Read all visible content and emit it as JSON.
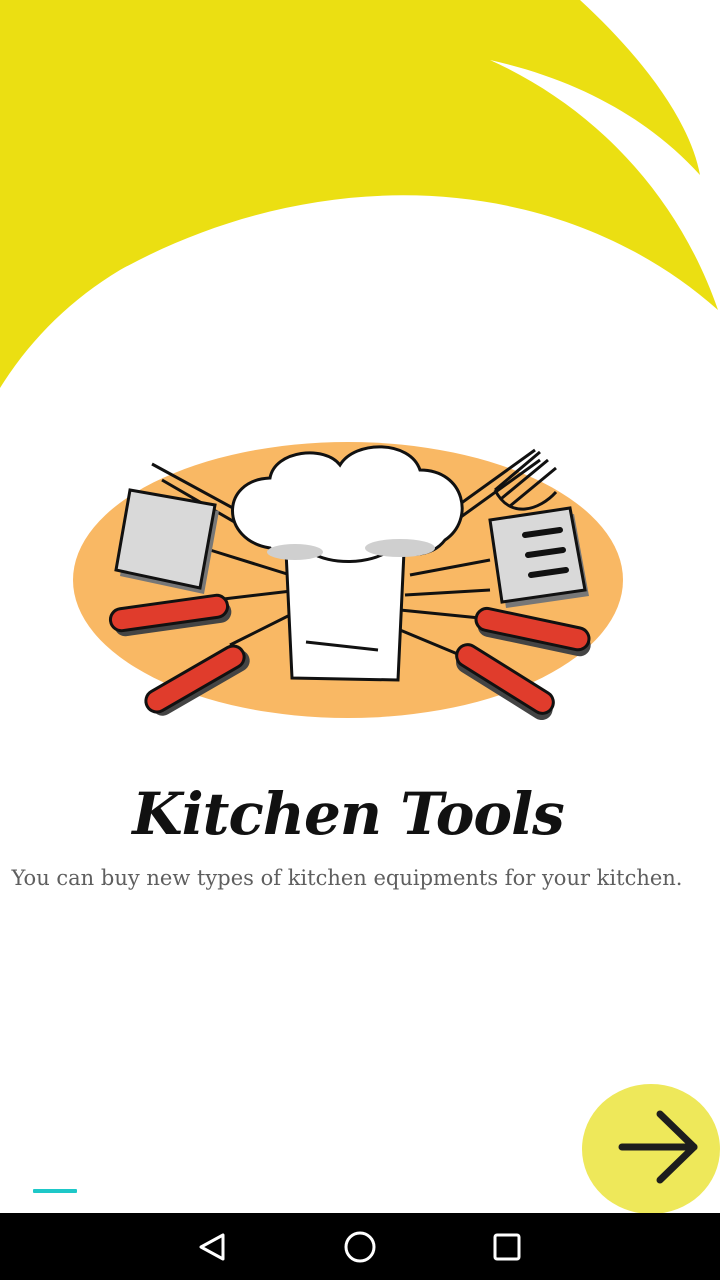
{
  "onboarding": {
    "title": "Kitchen Tools",
    "description": "You can buy new types of kitchen equipments for your kitchen.",
    "page_count": 1,
    "current_page": 1
  },
  "colors": {
    "accent_yellow": "#ebdf12",
    "button_yellow": "#eee85a",
    "indicator_cyan": "#1ec8c8",
    "illustration_orange": "#f9b864"
  },
  "icons": {
    "next": "arrow-right-icon",
    "illustration": "chef-hat-kitchen-tools-illustration",
    "nav_back": "triangle-back-icon",
    "nav_home": "circle-home-icon",
    "nav_recent": "square-recent-icon"
  }
}
